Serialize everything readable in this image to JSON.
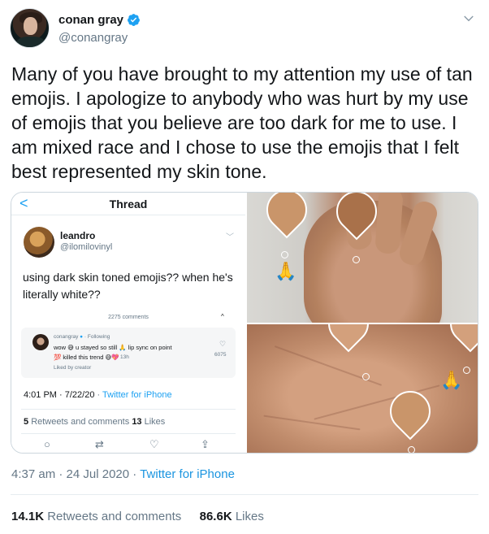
{
  "author": {
    "display_name": "conan gray",
    "handle": "@conangray"
  },
  "tweet": {
    "text": "Many of you have brought to my attention my use of tan emojis. I apologize to anybody who was hurt by my use of emojis that you believe are too dark for me to use. I am mixed race and I chose to use the emojis that I felt best represented my skin tone.",
    "time": "4:37 am",
    "date": "24 Jul 2020",
    "separator": "·",
    "source": "Twitter for iPhone"
  },
  "stats": {
    "retweets_count": "14.1K",
    "retweets_label": "Retweets and comments",
    "likes_count": "86.6K",
    "likes_label": "Likes"
  },
  "screenshot": {
    "nav_title": "Thread",
    "back_glyph": "<",
    "user": "leandro",
    "handle": "@ilomilovinyl",
    "text": "using dark skin toned emojis?? when he's literally white??",
    "comments_label": "2275 comments",
    "reply": {
      "name": "conangray",
      "following": "· Following",
      "line1": "wow 😅 u stayed so still 🙏 lip sync on point",
      "line2": "💯 killed this trend 😅💖",
      "time": "13h",
      "liked": "Liked by creator",
      "likes": "6075"
    },
    "date": "4:01 PM · 7/22/20",
    "via": "Twitter for iPhone",
    "retweets_count": "5",
    "retweets_label": "Retweets and comments",
    "likes_count": "13",
    "likes_label": "Likes"
  },
  "icons": {
    "verified": "verified-badge-icon",
    "caret": "chevron-down-icon",
    "pray": "🙏"
  },
  "colors": {
    "accent": "#1da1f2",
    "secondary_text": "#657786",
    "primary_text": "#14171a",
    "tan_swatch": "#c9956a",
    "dark_swatch": "#a9714a"
  }
}
